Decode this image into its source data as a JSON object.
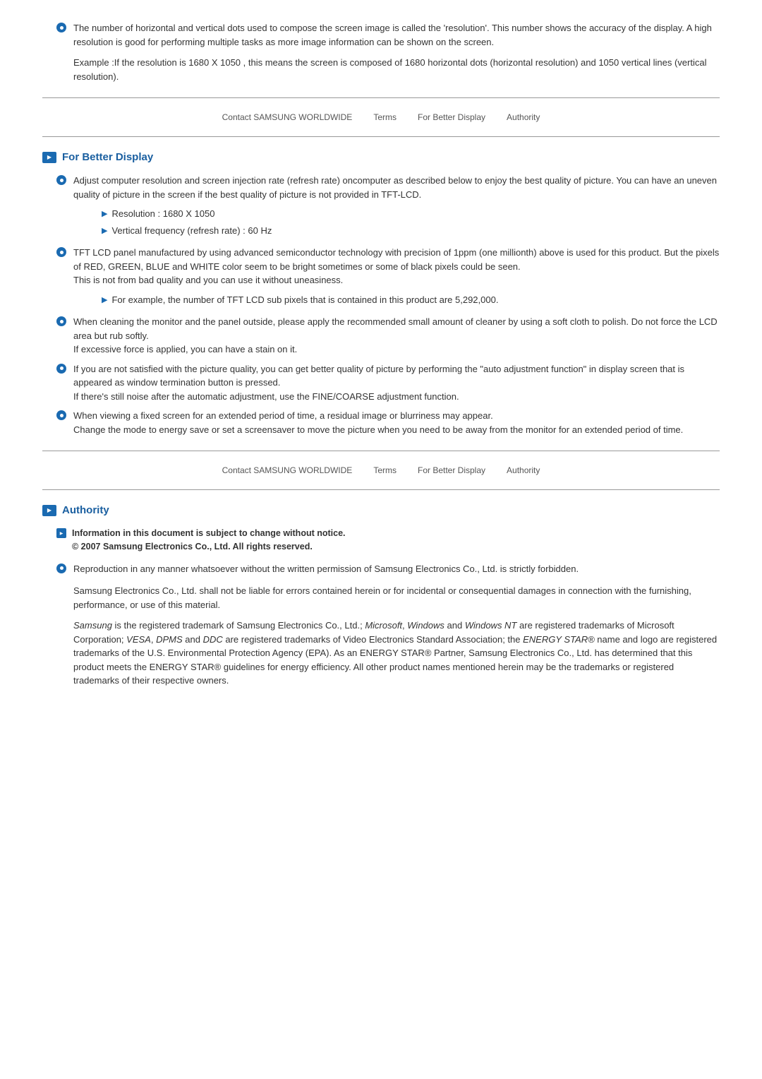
{
  "intro": {
    "bullet1": "The number of horizontal and vertical dots used to compose the screen image is called the 'resolution'. This number shows the accuracy of the display. A high resolution is good for performing multiple tasks as more image information can be shown on the screen.",
    "example": "Example :If the resolution is 1680 X 1050 , this means the screen is composed of 1680 horizontal dots (horizontal resolution) and 1050 vertical lines (vertical resolution)."
  },
  "nav": {
    "contact": "Contact SAMSUNG WORLDWIDE",
    "terms": "Terms",
    "for_better_display": "For Better Display",
    "authority": "Authority"
  },
  "for_better_display": {
    "title": "For Better Display",
    "bullets": [
      {
        "text": "Adjust computer resolution and screen injection rate (refresh rate) oncomputer as described below to enjoy the best quality of picture. You can have an uneven quality of picture in the screen if the best quality of picture is not provided in TFT-LCD.",
        "sub_items": [
          "Resolution : 1680 X 1050",
          "Vertical frequency (refresh rate) : 60 Hz"
        ]
      },
      {
        "text": "TFT LCD panel manufactured by using advanced semiconductor technology with precision of 1ppm (one millionth) above is used for this product. But the pixels of RED, GREEN, BLUE and WHITE color seem to be bright sometimes or some of black pixels could be seen.\nThis is not from bad quality and you can use it without uneasiness.",
        "sub_items": [
          "For example, the number of TFT LCD sub pixels that is contained in this product are 5,292,000."
        ]
      },
      {
        "text": "When cleaning the monitor and the panel outside, please apply the recommended small amount of cleaner by using a soft cloth to polish. Do not force the LCD area but rub softly.\nIf excessive force is applied, you can have a stain on it.",
        "sub_items": []
      },
      {
        "text": "If you are not satisfied with the picture quality, you can get better quality of picture by performing the \"auto adjustment function\" in display screen that is appeared as window termination button is pressed.\nIf there's still noise after the automatic adjustment, use the FINE/COARSE adjustment function.",
        "sub_items": []
      },
      {
        "text": "When viewing a fixed screen for an extended period of time, a residual image or blurriness may appear.\nChange the mode to energy save or set a screensaver to move the picture when you need to be away from the monitor for an extended period of time.",
        "sub_items": []
      }
    ]
  },
  "authority": {
    "title": "Authority",
    "notice_line1": "Information in this document is subject to change without notice.",
    "notice_line2": "© 2007 Samsung Electronics Co., Ltd. All rights reserved.",
    "bullet1": "Reproduction in any manner whatsoever without the written permission of Samsung Electronics Co., Ltd. is strictly forbidden.",
    "paragraph1": "Samsung Electronics Co., Ltd. shall not be liable for errors contained herein or for incidental or consequential damages in connection with the furnishing, performance, or use of this material.",
    "paragraph2_parts": [
      {
        "text": "Samsung",
        "italic": true
      },
      {
        "text": " is the registered trademark of Samsung Electronics Co., Ltd.; ",
        "italic": false
      },
      {
        "text": "Microsoft",
        "italic": true
      },
      {
        "text": ", ",
        "italic": false
      },
      {
        "text": "Windows",
        "italic": true
      },
      {
        "text": " and ",
        "italic": false
      },
      {
        "text": "Windows NT",
        "italic": true
      },
      {
        "text": " are registered trademarks of Microsoft Corporation; ",
        "italic": false
      },
      {
        "text": "VESA",
        "italic": true
      },
      {
        "text": ", ",
        "italic": false
      },
      {
        "text": "DPMS",
        "italic": true
      },
      {
        "text": " and ",
        "italic": false
      },
      {
        "text": "DDC",
        "italic": true
      },
      {
        "text": " are registered trademarks of Video Electronics Standard Association; the ",
        "italic": false
      },
      {
        "text": "ENERGY STAR®",
        "italic": true
      },
      {
        "text": " name and logo are registered trademarks of the U.S. Environmental Protection Agency (EPA). As an ENERGY STAR® Partner, Samsung Electronics Co., Ltd. has determined that this product meets the ENERGY STAR® guidelines for energy efficiency. All other product names mentioned herein may be the trademarks or registered trademarks of their respective owners.",
        "italic": false
      }
    ]
  }
}
